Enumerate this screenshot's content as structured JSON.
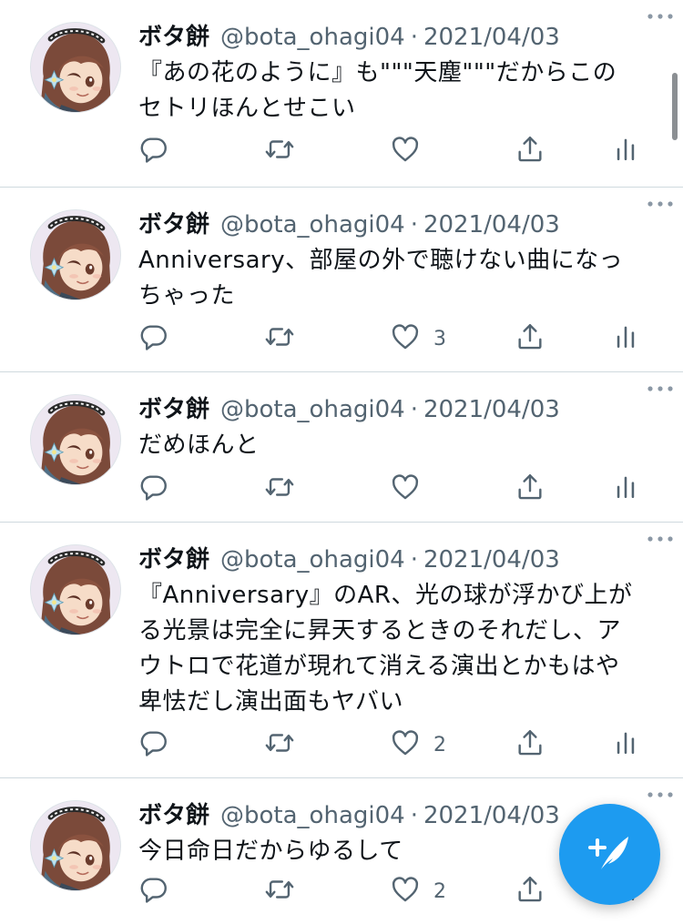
{
  "author": {
    "name": "ボタ餅",
    "handle": "@bota_ohagi04"
  },
  "separator": "·",
  "icons": {
    "reply": "reply-icon",
    "retweet": "retweet-icon",
    "like": "like-icon",
    "share": "share-icon",
    "analytics": "analytics-icon",
    "more": "more-icon",
    "compose": "compose-icon"
  },
  "colors": {
    "accent": "#1d9bf0",
    "secondary_text": "#536471",
    "divider": "#cfd9de"
  },
  "tweets": [
    {
      "date": "2021/04/03",
      "lines": [
        "『あの花のように』も\"\"\"天塵\"\"\"だからこの",
        "セトリほんとせこい"
      ],
      "like_count": ""
    },
    {
      "date": "2021/04/03",
      "lines": [
        "Anniversary、部屋の外で聴けない曲になっ",
        "ちゃった"
      ],
      "like_count": "3"
    },
    {
      "date": "2021/04/03",
      "lines": [
        "だめほんと"
      ],
      "like_count": ""
    },
    {
      "date": "2021/04/03",
      "lines": [
        "『Anniversary』のAR、光の球が浮かび上が",
        "る光景は完全に昇天するときのそれだし、ア",
        "ウトロで花道が現れて消える演出とかもはや",
        "卑怯だし演出面もヤバい"
      ],
      "like_count": "2"
    },
    {
      "date": "2021/04/03",
      "lines": [
        "今日命日だからゆるして"
      ],
      "like_count": "2"
    }
  ]
}
